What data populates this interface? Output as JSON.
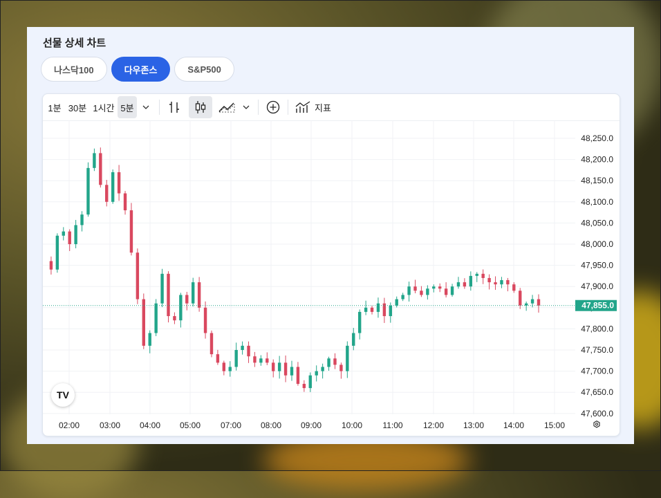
{
  "panel": {
    "title": "선물 상세 차트"
  },
  "tabs": [
    {
      "label": "나스닥100",
      "active": false
    },
    {
      "label": "다우존스",
      "active": true
    },
    {
      "label": "S&P500",
      "active": false
    }
  ],
  "toolbar": {
    "intervals": [
      "1분",
      "30분",
      "1시간",
      "5분"
    ],
    "selected_interval": "5분",
    "indicator_label": "지표",
    "icons": [
      "chevron-down-icon",
      "bar-chart-icon",
      "candlestick-icon",
      "area-chart-icon",
      "chevron-down-icon",
      "add-circle-icon",
      "indicator-icon"
    ]
  },
  "colors": {
    "up": "#22a58a",
    "down": "#d9485f",
    "accent": "#2a63e5",
    "price_tag": "#22a58a"
  },
  "logo_text": "TV",
  "chart_data": {
    "type": "candlestick",
    "x_ticks": [
      "02:00",
      "03:00",
      "04:00",
      "05:00",
      "07:00",
      "08:00",
      "09:00",
      "10:00",
      "11:00",
      "12:00",
      "13:00",
      "14:00",
      "15:00"
    ],
    "y_ticks": [
      "48,250.0",
      "48,200.0",
      "48,150.0",
      "48,100.0",
      "48,050.0",
      "48,000.0",
      "47,950.0",
      "47,900.0",
      "47,850.0",
      "47,800.0",
      "47,750.0",
      "47,700.0",
      "47,650.0",
      "47,600.0"
    ],
    "ylim": [
      47600,
      48250
    ],
    "current_price": 47855.0,
    "current_price_label": "47,855.0",
    "close_path": [
      47960,
      47940,
      48020,
      48030,
      48000,
      48045,
      48070,
      48180,
      48215,
      48140,
      48100,
      48170,
      48120,
      48080,
      47980,
      47870,
      47760,
      47790,
      47860,
      47930,
      47830,
      47820,
      47880,
      47860,
      47910,
      47850,
      47790,
      47740,
      47720,
      47700,
      47710,
      47750,
      47760,
      47735,
      47720,
      47730,
      47720,
      47700,
      47720,
      47690,
      47710,
      47670,
      47660,
      47690,
      47700,
      47710,
      47730,
      47715,
      47700,
      47760,
      47790,
      47840,
      47850,
      47840,
      47860,
      47830,
      47855,
      47870,
      47880,
      47900,
      47890,
      47880,
      47895,
      47900,
      47895,
      47880,
      47900,
      47910,
      47900,
      47925,
      47930,
      47920,
      47910,
      47905,
      47915,
      47905,
      47890,
      47855,
      47860,
      47870,
      47855
    ],
    "grid": true
  }
}
